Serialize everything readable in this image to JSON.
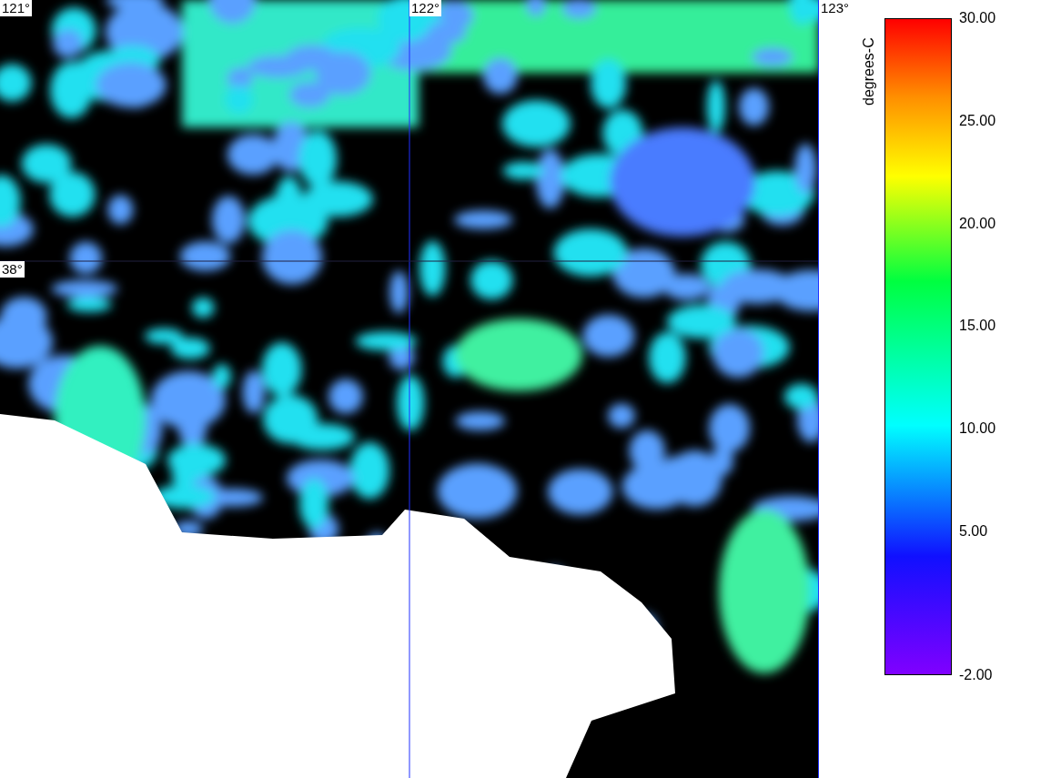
{
  "map": {
    "longitude_labels": [
      "121°",
      "122°",
      "123°"
    ],
    "latitude_labels": [
      "38°"
    ]
  },
  "colorbar": {
    "title": "degrees-C",
    "ticks": [
      "30.00",
      "25.00",
      "20.00",
      "15.00",
      "10.00",
      "5.00",
      "-2.00"
    ]
  }
}
